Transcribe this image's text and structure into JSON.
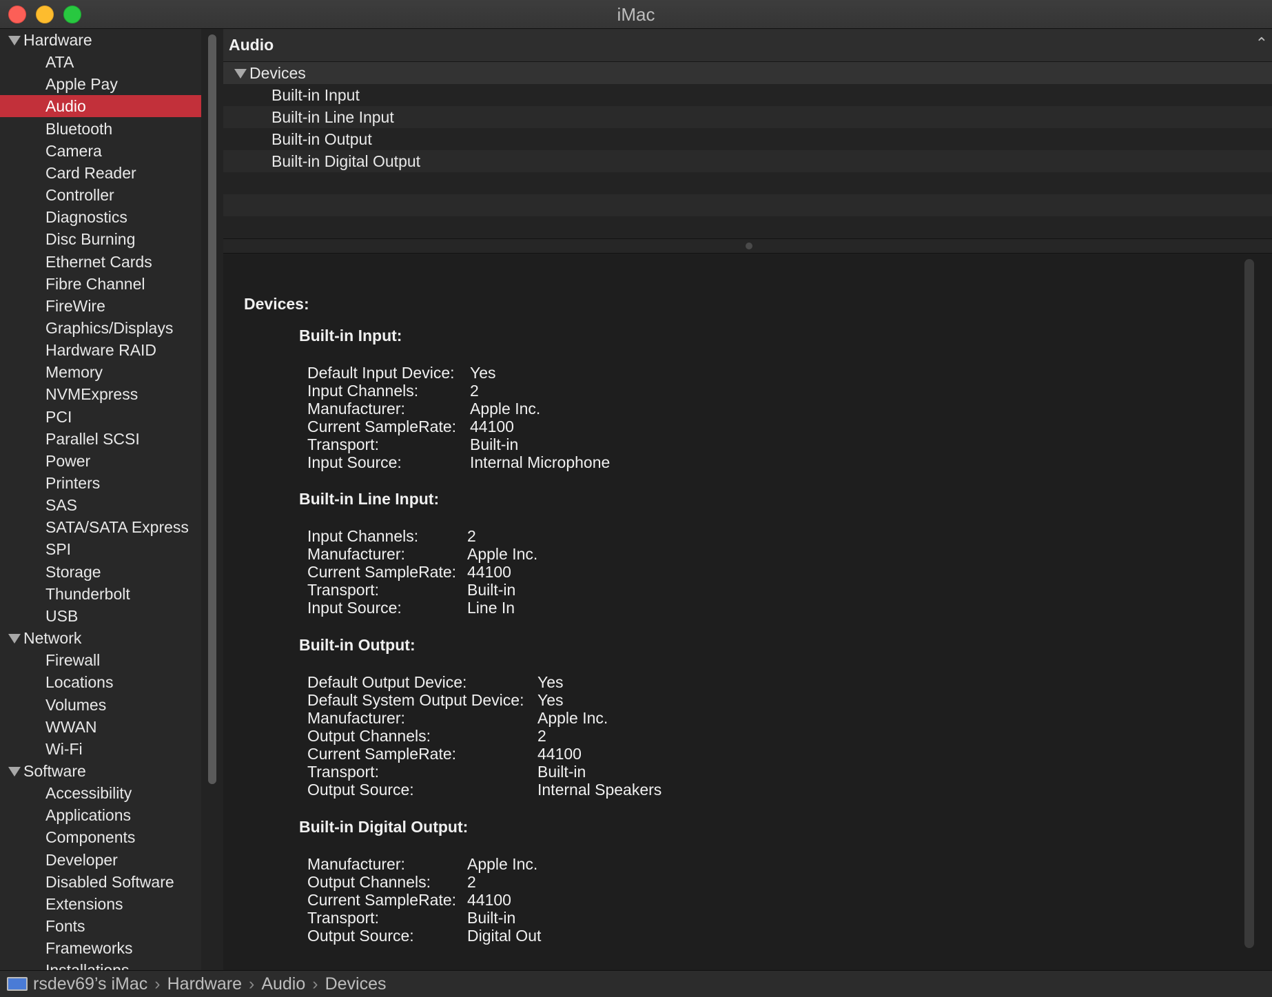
{
  "window": {
    "title": "iMac"
  },
  "sidebar": {
    "rows": [
      {
        "label": "Hardware",
        "kind": "group"
      },
      {
        "label": "ATA",
        "kind": "item"
      },
      {
        "label": "Apple Pay",
        "kind": "item"
      },
      {
        "label": "Audio",
        "kind": "item",
        "selected": true
      },
      {
        "label": "Bluetooth",
        "kind": "item"
      },
      {
        "label": "Camera",
        "kind": "item"
      },
      {
        "label": "Card Reader",
        "kind": "item"
      },
      {
        "label": "Controller",
        "kind": "item"
      },
      {
        "label": "Diagnostics",
        "kind": "item"
      },
      {
        "label": "Disc Burning",
        "kind": "item"
      },
      {
        "label": "Ethernet Cards",
        "kind": "item"
      },
      {
        "label": "Fibre Channel",
        "kind": "item"
      },
      {
        "label": "FireWire",
        "kind": "item"
      },
      {
        "label": "Graphics/Displays",
        "kind": "item"
      },
      {
        "label": "Hardware RAID",
        "kind": "item"
      },
      {
        "label": "Memory",
        "kind": "item"
      },
      {
        "label": "NVMExpress",
        "kind": "item"
      },
      {
        "label": "PCI",
        "kind": "item"
      },
      {
        "label": "Parallel SCSI",
        "kind": "item"
      },
      {
        "label": "Power",
        "kind": "item"
      },
      {
        "label": "Printers",
        "kind": "item"
      },
      {
        "label": "SAS",
        "kind": "item"
      },
      {
        "label": "SATA/SATA Express",
        "kind": "item"
      },
      {
        "label": "SPI",
        "kind": "item"
      },
      {
        "label": "Storage",
        "kind": "item"
      },
      {
        "label": "Thunderbolt",
        "kind": "item"
      },
      {
        "label": "USB",
        "kind": "item"
      },
      {
        "label": "Network",
        "kind": "group"
      },
      {
        "label": "Firewall",
        "kind": "item"
      },
      {
        "label": "Locations",
        "kind": "item"
      },
      {
        "label": "Volumes",
        "kind": "item"
      },
      {
        "label": "WWAN",
        "kind": "item"
      },
      {
        "label": "Wi-Fi",
        "kind": "item"
      },
      {
        "label": "Software",
        "kind": "group"
      },
      {
        "label": "Accessibility",
        "kind": "item"
      },
      {
        "label": "Applications",
        "kind": "item"
      },
      {
        "label": "Components",
        "kind": "item"
      },
      {
        "label": "Developer",
        "kind": "item"
      },
      {
        "label": "Disabled Software",
        "kind": "item"
      },
      {
        "label": "Extensions",
        "kind": "item"
      },
      {
        "label": "Fonts",
        "kind": "item"
      },
      {
        "label": "Frameworks",
        "kind": "item"
      },
      {
        "label": "Installations",
        "kind": "item"
      }
    ]
  },
  "section": {
    "title": "Audio"
  },
  "device_list": {
    "group_label": "Devices",
    "items": [
      "Built-in Input",
      "Built-in Line Input",
      "Built-in Output",
      "Built-in Digital Output"
    ]
  },
  "detail": {
    "heading": "Devices:",
    "devices": [
      {
        "name": "Built-in Input:",
        "props": [
          [
            "Default Input Device:",
            "Yes"
          ],
          [
            "Input Channels:",
            "2"
          ],
          [
            "Manufacturer:",
            "Apple Inc."
          ],
          [
            "Current SampleRate:",
            "44100"
          ],
          [
            "Transport:",
            "Built-in"
          ],
          [
            "Input Source:",
            "Internal Microphone"
          ]
        ]
      },
      {
        "name": "Built-in Line Input:",
        "props": [
          [
            "Input Channels:",
            "2"
          ],
          [
            "Manufacturer:",
            "Apple Inc."
          ],
          [
            "Current SampleRate:",
            "44100"
          ],
          [
            "Transport:",
            "Built-in"
          ],
          [
            "Input Source:",
            "Line In"
          ]
        ]
      },
      {
        "name": "Built-in Output:",
        "props": [
          [
            "Default Output Device:",
            "Yes"
          ],
          [
            "Default System Output Device:",
            "Yes"
          ],
          [
            "Manufacturer:",
            "Apple Inc."
          ],
          [
            "Output Channels:",
            "2"
          ],
          [
            "Current SampleRate:",
            "44100"
          ],
          [
            "Transport:",
            "Built-in"
          ],
          [
            "Output Source:",
            "Internal Speakers"
          ]
        ]
      },
      {
        "name": "Built-in Digital Output:",
        "props": [
          [
            "Manufacturer:",
            "Apple Inc."
          ],
          [
            "Output Channels:",
            "2"
          ],
          [
            "Current SampleRate:",
            "44100"
          ],
          [
            "Transport:",
            "Built-in"
          ],
          [
            "Output Source:",
            "Digital Out"
          ]
        ]
      }
    ]
  },
  "breadcrumb": {
    "icon": "imac-icon",
    "parts": [
      "rsdev69’s iMac",
      "Hardware",
      "Audio",
      "Devices"
    ],
    "separator": "›"
  }
}
